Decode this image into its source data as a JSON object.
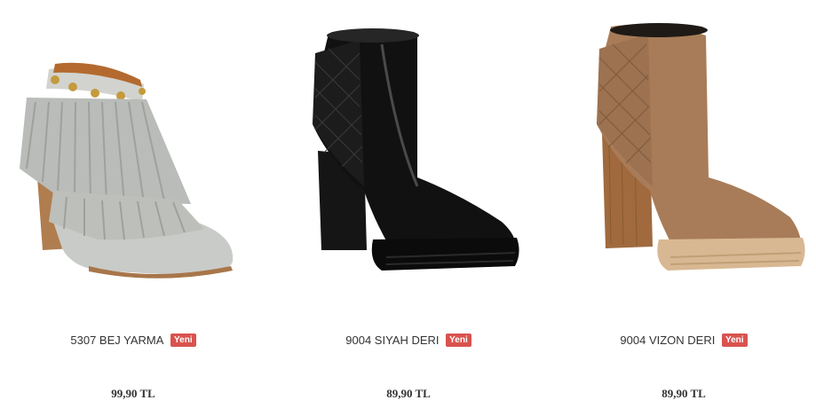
{
  "products": [
    {
      "name": "5307 BEJ YARMA",
      "badge": "Yeni",
      "price": "99,90 TL",
      "icon": "fringe-bootie-image",
      "colors": {
        "upper": "#c4c6c2",
        "heel": "#b07d4f",
        "accent": "#c59a3c"
      }
    },
    {
      "name": "9004 SIYAH DERI",
      "badge": "Yeni",
      "price": "89,90 TL",
      "icon": "black-quilted-boot-image",
      "colors": {
        "upper": "#111111",
        "heel": "#151515",
        "sole": "#0b0b0b"
      }
    },
    {
      "name": "9004 VIZON DERI",
      "badge": "Yeni",
      "price": "89,90 TL",
      "icon": "mink-quilted-boot-image",
      "colors": {
        "upper": "#a87c58",
        "heel": "#a06a3e",
        "sole": "#d8b892"
      }
    }
  ],
  "badge_color": "#d9534f"
}
